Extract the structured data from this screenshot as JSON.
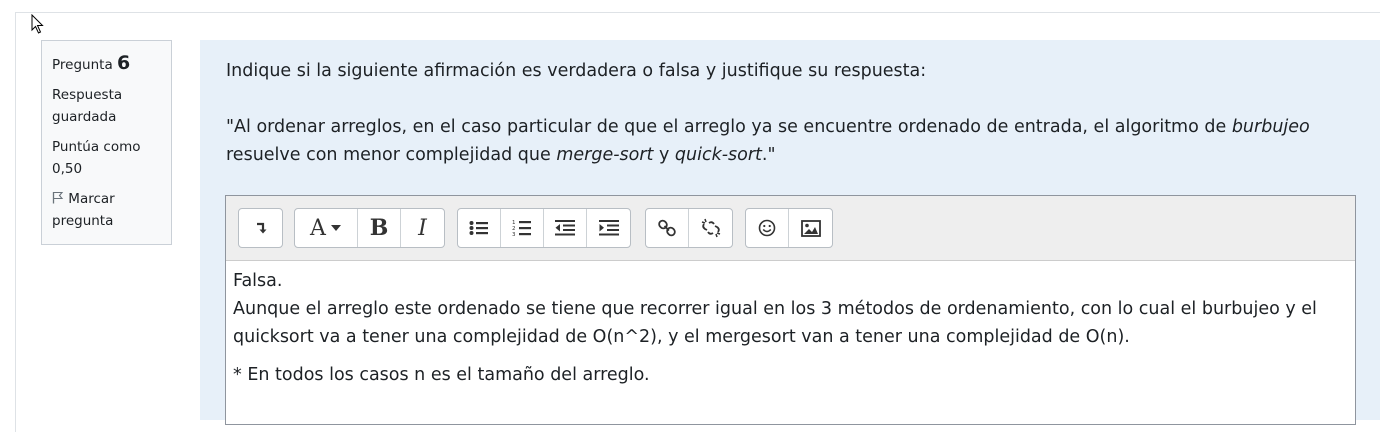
{
  "info": {
    "question_label": "Pregunta",
    "question_number": "6",
    "status": "Respuesta guardada",
    "marks": "Puntúa como 0,50",
    "flag": "Marcar pregunta"
  },
  "question": {
    "prompt": "Indique si la siguiente afirmación es verdadera o falsa y justifique su respuesta:",
    "statement_part1": "\"Al ordenar arreglos, en el caso particular de que el arreglo ya se encuentre ordenado de entrada, el algoritmo de ",
    "statement_em1": "burbujeo",
    "statement_part2": " resuelve con menor complejidad que ",
    "statement_em2": "merge-sort",
    "statement_part3": " y ",
    "statement_em3": "quick-sort",
    "statement_part4": ".\""
  },
  "editor": {
    "toolbar_icons": [
      "collapse-icon",
      "font-style-icon",
      "bold-icon",
      "italic-icon",
      "unordered-list-icon",
      "ordered-list-icon",
      "outdent-icon",
      "indent-icon",
      "link-icon",
      "unlink-icon",
      "emoji-icon",
      "image-icon"
    ],
    "bold_glyph": "B",
    "italic_glyph": "I",
    "font_glyph": "A",
    "answer_line1": "Falsa.",
    "answer_line2": "Aunque el arreglo este ordenado se tiene que recorrer igual en los 3 métodos de ordenamiento, con lo cual el burbujeo y el quicksort va a tener una complejidad de O(n^2), y el mergesort van a tener una complejidad de O(n).",
    "answer_line3": "* En todos los casos n es el tamaño del arreglo."
  }
}
